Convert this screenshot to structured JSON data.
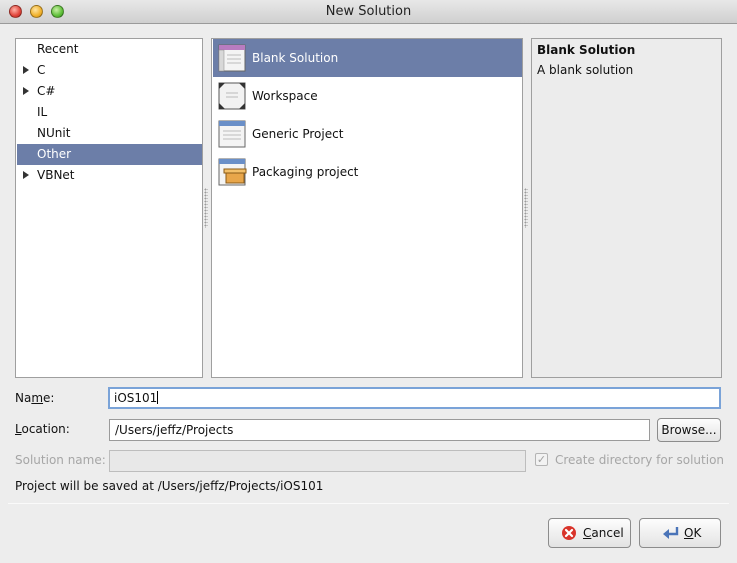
{
  "window": {
    "title": "New Solution"
  },
  "categories": [
    {
      "label": "Recent",
      "expandable": false,
      "selected": false
    },
    {
      "label": "C",
      "expandable": true,
      "selected": false
    },
    {
      "label": "C#",
      "expandable": true,
      "selected": false
    },
    {
      "label": "IL",
      "expandable": false,
      "selected": false
    },
    {
      "label": "NUnit",
      "expandable": false,
      "selected": false
    },
    {
      "label": "Other",
      "expandable": false,
      "selected": true
    },
    {
      "label": "VBNet",
      "expandable": true,
      "selected": false
    }
  ],
  "templates": [
    {
      "label": "Blank Solution",
      "icon": "blank-solution-icon",
      "selected": true
    },
    {
      "label": "Workspace",
      "icon": "workspace-icon",
      "selected": false
    },
    {
      "label": "Generic Project",
      "icon": "generic-project-icon",
      "selected": false
    },
    {
      "label": "Packaging project",
      "icon": "packaging-project-icon",
      "selected": false
    }
  ],
  "description": {
    "title": "Blank Solution",
    "text": "A blank solution"
  },
  "form": {
    "name_label_pre": "Na",
    "name_label_mnemonic": "m",
    "name_label_post": "e:",
    "name_value": "iOS101",
    "location_label_mnemonic": "L",
    "location_label_rest": "ocation:",
    "location_value": "/Users/jeffz/Projects",
    "browse_label": "Browse...",
    "solution_name_label": "Solution name:",
    "solution_name_value": "",
    "create_dir_label": "Create directory for solution",
    "create_dir_checked": true,
    "saved_at_text": "Project will be saved at /Users/jeffz/Projects/iOS101"
  },
  "buttons": {
    "cancel_mnemonic": "C",
    "cancel_rest": "ancel",
    "ok_mnemonic": "O",
    "ok_rest": "K"
  },
  "colors": {
    "selection": "#6c7ea8",
    "focus_ring": "#7aa3d8"
  }
}
